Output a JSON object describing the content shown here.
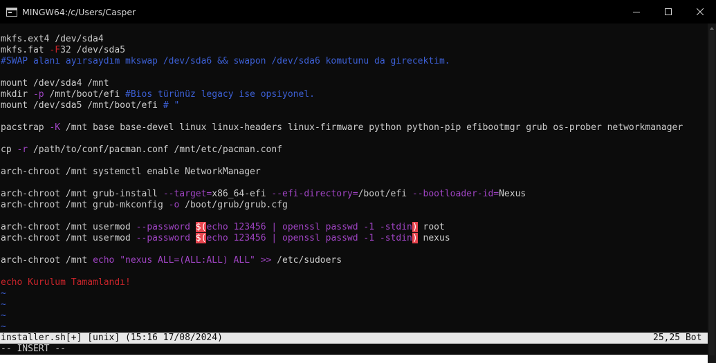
{
  "window": {
    "title": "MINGW64:/c/Users/Casper",
    "icon": "console-icon",
    "controls": [
      "minimize-icon",
      "maximize-icon",
      "close-icon"
    ]
  },
  "editor": {
    "lines": [
      {
        "id": "l1",
        "segments": [
          {
            "t": "mkfs.ext4 /dev/sda4",
            "c": "white"
          }
        ]
      },
      {
        "id": "l2",
        "segments": [
          {
            "t": "mkfs.fat ",
            "c": "white"
          },
          {
            "t": "-F",
            "c": "red"
          },
          {
            "t": "32 /dev/sda5",
            "c": "white"
          }
        ]
      },
      {
        "id": "l3",
        "segments": [
          {
            "t": "#SWAP alanı ayırsaydım mkswap /dev/sda6 && swapon /dev/sda6 komutunu da girecektim.",
            "c": "blue"
          }
        ]
      },
      {
        "id": "l4",
        "segments": []
      },
      {
        "id": "l5",
        "segments": [
          {
            "t": "mount /dev/sda4 /mnt",
            "c": "white"
          }
        ]
      },
      {
        "id": "l6",
        "segments": [
          {
            "t": "mkdir ",
            "c": "white"
          },
          {
            "t": "-p",
            "c": "purple"
          },
          {
            "t": " /mnt/boot/efi ",
            "c": "white"
          },
          {
            "t": "#Bios türünüz legacy ise opsiyonel.",
            "c": "blue"
          }
        ]
      },
      {
        "id": "l7",
        "segments": [
          {
            "t": "mount /dev/sda5 /mnt/boot/efi ",
            "c": "white"
          },
          {
            "t": "# \"",
            "c": "blue"
          }
        ]
      },
      {
        "id": "l8",
        "segments": []
      },
      {
        "id": "l9",
        "segments": [
          {
            "t": "pacstrap ",
            "c": "white"
          },
          {
            "t": "-K",
            "c": "purple"
          },
          {
            "t": " /mnt base base-devel linux linux-headers linux-firmware python python-pip efibootmgr grub os-prober networkmanager",
            "c": "white"
          }
        ]
      },
      {
        "id": "l10",
        "segments": []
      },
      {
        "id": "l11",
        "segments": [
          {
            "t": "cp ",
            "c": "white"
          },
          {
            "t": "-r",
            "c": "purple"
          },
          {
            "t": " /path/to/conf/pacman.conf /mnt/etc/pacman.conf",
            "c": "white"
          }
        ]
      },
      {
        "id": "l12",
        "segments": []
      },
      {
        "id": "l13",
        "segments": [
          {
            "t": "arch-chroot /mnt systemctl enable NetworkManager",
            "c": "white"
          }
        ]
      },
      {
        "id": "l14",
        "segments": []
      },
      {
        "id": "l15",
        "segments": [
          {
            "t": "arch-chroot /mnt grub-install ",
            "c": "white"
          },
          {
            "t": "--target=",
            "c": "purple"
          },
          {
            "t": "x86_64-efi ",
            "c": "white"
          },
          {
            "t": "--efi-directory=",
            "c": "purple"
          },
          {
            "t": "/boot/efi ",
            "c": "white"
          },
          {
            "t": "--bootloader-id=",
            "c": "purple"
          },
          {
            "t": "Nexus",
            "c": "white"
          }
        ]
      },
      {
        "id": "l16",
        "segments": [
          {
            "t": "arch-chroot /mnt grub-mkconfig ",
            "c": "white"
          },
          {
            "t": "-o",
            "c": "purple"
          },
          {
            "t": " /boot/grub/grub.cfg",
            "c": "white"
          }
        ]
      },
      {
        "id": "l17",
        "segments": []
      },
      {
        "id": "l18",
        "segments": [
          {
            "t": "arch-chroot /mnt usermod ",
            "c": "white"
          },
          {
            "t": "--password",
            "c": "purple"
          },
          {
            "t": " ",
            "c": "white"
          },
          {
            "t": "$(",
            "c": "hl"
          },
          {
            "t": "echo 123456 | openssl passwd -1 -stdin",
            "c": "purple"
          },
          {
            "t": ")",
            "c": "hl"
          },
          {
            "t": " root",
            "c": "white"
          }
        ]
      },
      {
        "id": "l19",
        "segments": [
          {
            "t": "arch-chroot /mnt usermod ",
            "c": "white"
          },
          {
            "t": "--password",
            "c": "purple"
          },
          {
            "t": " ",
            "c": "white"
          },
          {
            "t": "$(",
            "c": "hl"
          },
          {
            "t": "echo 123456 | openssl passwd -1 -stdin",
            "c": "purple"
          },
          {
            "t": ")",
            "c": "hl"
          },
          {
            "t": " nexus",
            "c": "white"
          }
        ]
      },
      {
        "id": "l20",
        "segments": []
      },
      {
        "id": "l21",
        "segments": [
          {
            "t": "arch-chroot /mnt ",
            "c": "white"
          },
          {
            "t": "echo \"nexus ALL=(ALL:ALL) ALL\" >>",
            "c": "purple"
          },
          {
            "t": " /etc/sudoers",
            "c": "white"
          }
        ]
      },
      {
        "id": "l22",
        "segments": []
      },
      {
        "id": "l23",
        "segments": [
          {
            "t": "echo Kurulum Tamamlandı!",
            "c": "red"
          }
        ]
      },
      {
        "id": "l24",
        "segments": [
          {
            "t": "~",
            "c": "blue"
          }
        ]
      },
      {
        "id": "l25",
        "segments": [
          {
            "t": "~",
            "c": "blue"
          }
        ]
      },
      {
        "id": "l26",
        "segments": [
          {
            "t": "~",
            "c": "blue"
          }
        ]
      },
      {
        "id": "l27",
        "segments": [
          {
            "t": "~",
            "c": "blue"
          }
        ]
      }
    ]
  },
  "statusline": {
    "left": "installer.sh[+] [unix] (15:16 17/08/2024)",
    "right": "25,25 Bot"
  },
  "mode": "-- INSERT --",
  "colors": {
    "background": "#0c0c0c",
    "text": "#cccccc",
    "comment_blue": "#3c5fd4",
    "option_purple": "#a044c4",
    "error_red": "#c8242a",
    "highlight": "#e8454f"
  }
}
